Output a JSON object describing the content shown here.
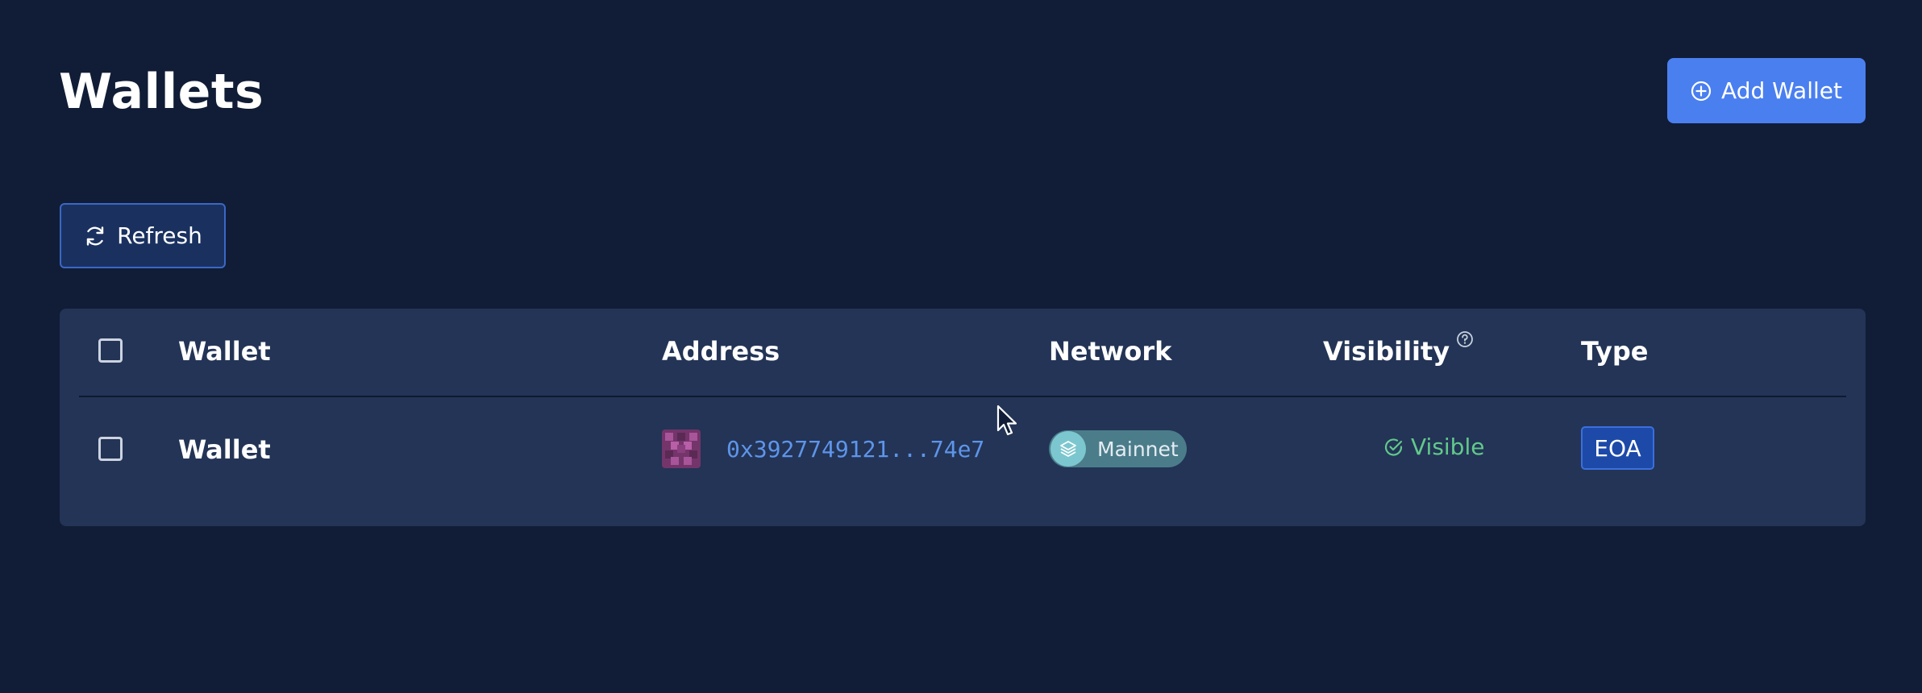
{
  "page": {
    "title": "Wallets"
  },
  "toolbar": {
    "add_wallet_label": "Add Wallet",
    "refresh_label": "Refresh"
  },
  "table": {
    "columns": [
      "Wallet",
      "Address",
      "Network",
      "Visibility",
      "Type"
    ],
    "rows": [
      {
        "wallet": "Wallet",
        "address": "0x3927749121...74e7",
        "network": "Mainnet",
        "visibility": "Visible",
        "type": "EOA"
      }
    ]
  },
  "icons": {
    "add": "plus-circle-icon",
    "refresh": "refresh-icon",
    "help": "question-circle-icon",
    "network": "layers-icon",
    "visible": "check-circle-icon",
    "identicon": "identicon"
  },
  "colors": {
    "background": "#111d36",
    "card": "#233456",
    "primary": "#4a7ff0",
    "address": "#5e95ea",
    "visible": "#62c98b",
    "network_pill": "#4b7c8a"
  }
}
